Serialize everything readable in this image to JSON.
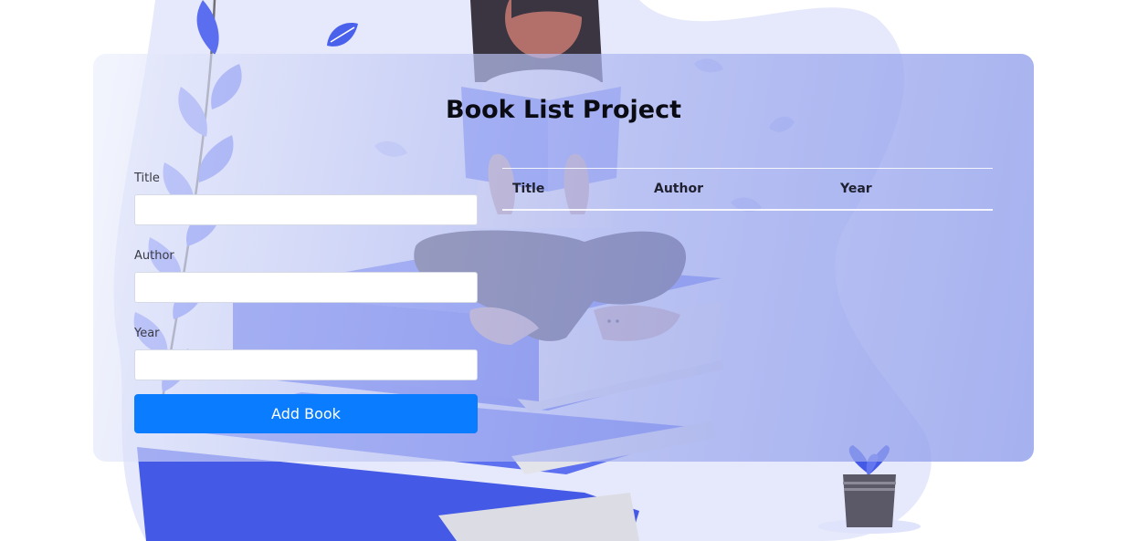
{
  "page": {
    "title": "Book List Project"
  },
  "form": {
    "title_label": "Title",
    "title_value": "",
    "author_label": "Author",
    "author_value": "",
    "year_label": "Year",
    "year_value": "",
    "submit_label": "Add Book"
  },
  "table": {
    "columns": [
      "Title",
      "Author",
      "Year"
    ],
    "rows": []
  },
  "colors": {
    "accent": "#0a7cff",
    "illustration_blue": "#5b6ef0",
    "card_tint": "#aab4f0",
    "title_text": "#0b0b14"
  },
  "icons": {
    "background": "reading-woman-books-illustration",
    "plant": "potted-plant-icon",
    "leaf": "leaf-icon"
  }
}
